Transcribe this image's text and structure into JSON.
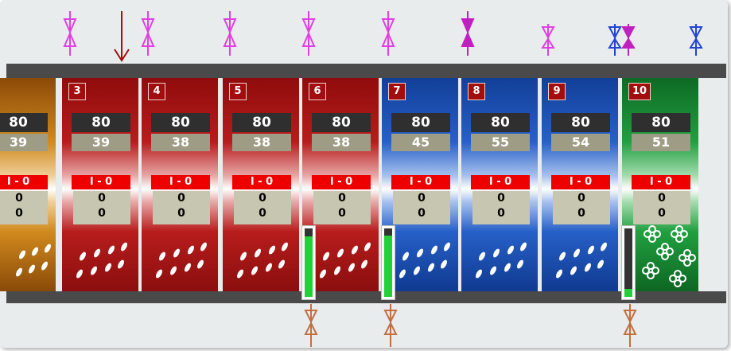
{
  "colors": {
    "valve_top": "#e040e0",
    "valve_top_active": "#c020c0",
    "valve_blue": "#2244d0",
    "valve_bottom": "#c07040",
    "arrow": "#a01010",
    "rail": "#4a4a4a",
    "level_fill": "#22d03a"
  },
  "modules": [
    {
      "number": "",
      "setpoint": "80",
      "actual": "39",
      "status": "I - 0",
      "value1": "0",
      "value2": "0",
      "color": "orange",
      "pattern": "drops"
    },
    {
      "number": "3",
      "setpoint": "80",
      "actual": "39",
      "status": "I - 0",
      "value1": "0",
      "value2": "0",
      "color": "red",
      "pattern": "drops"
    },
    {
      "number": "4",
      "setpoint": "80",
      "actual": "38",
      "status": "I - 0",
      "value1": "0",
      "value2": "0",
      "color": "red",
      "pattern": "drops"
    },
    {
      "number": "5",
      "setpoint": "80",
      "actual": "38",
      "status": "I - 0",
      "value1": "0",
      "value2": "0",
      "color": "red",
      "pattern": "drops"
    },
    {
      "number": "6",
      "setpoint": "80",
      "actual": "38",
      "status": "I - 0",
      "value1": "0",
      "value2": "0",
      "color": "red",
      "pattern": "drops"
    },
    {
      "number": "7",
      "setpoint": "80",
      "actual": "45",
      "status": "I - 0",
      "value1": "0",
      "value2": "0",
      "color": "blue",
      "pattern": "drops"
    },
    {
      "number": "8",
      "setpoint": "80",
      "actual": "55",
      "status": "I - 0",
      "value1": "0",
      "value2": "0",
      "color": "blue",
      "pattern": "drops"
    },
    {
      "number": "9",
      "setpoint": "80",
      "actual": "54",
      "status": "I - 0",
      "value1": "0",
      "value2": "0",
      "color": "blue",
      "pattern": "drops"
    },
    {
      "number": "10",
      "setpoint": "80",
      "actual": "51",
      "status": "I - 0",
      "value1": "0",
      "value2": "0",
      "color": "green",
      "pattern": "flowers"
    }
  ],
  "level_gauges": [
    {
      "fill_fraction": 0.88
    },
    {
      "fill_fraction": 0.9
    },
    {
      "fill_fraction": 0.12
    }
  ]
}
